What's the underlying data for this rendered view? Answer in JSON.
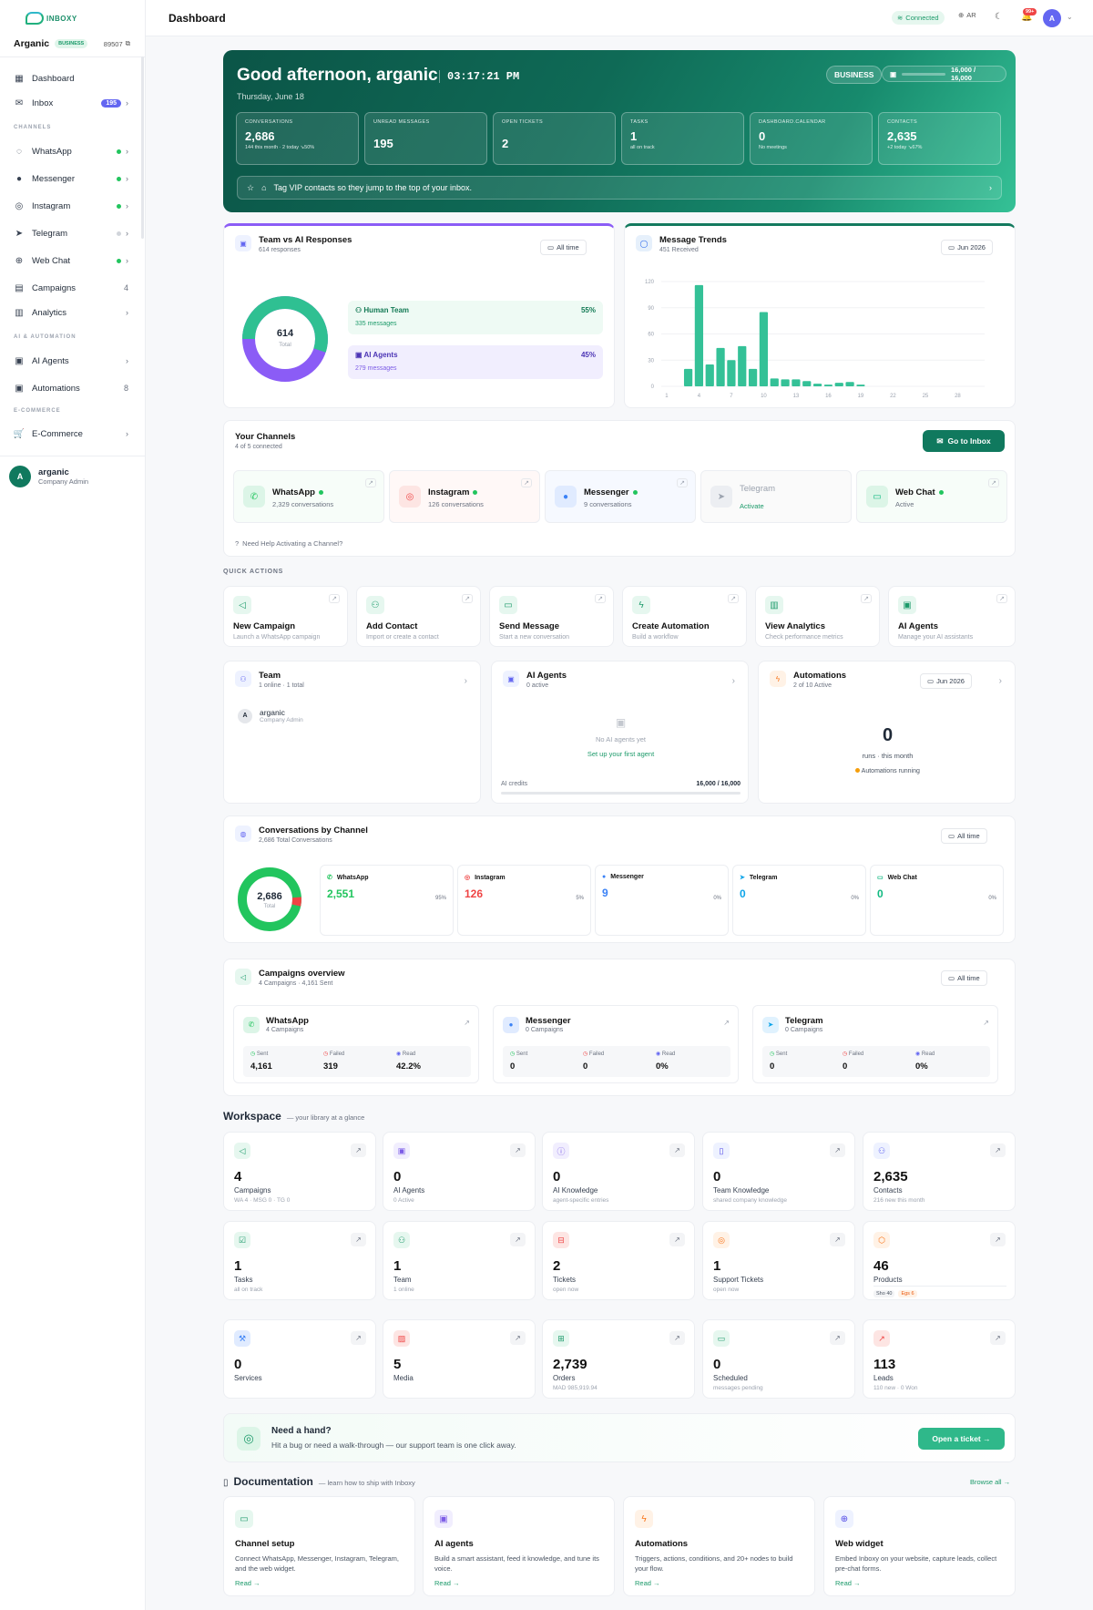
{
  "app": {
    "brand": "INBOXY",
    "page_title": "Dashboard"
  },
  "sidebar": {
    "workspace": "Arganic",
    "plan_badge": "BUSINESS",
    "workspace_id": "89507",
    "items": [
      {
        "label": "Dashboard",
        "icon": "grid-icon"
      },
      {
        "label": "Inbox",
        "icon": "inbox-icon",
        "badge": "195"
      },
      {
        "label": "WhatsApp",
        "icon": "whatsapp-icon"
      },
      {
        "label": "Messenger",
        "icon": "messenger-icon"
      },
      {
        "label": "Instagram",
        "icon": "instagram-icon"
      },
      {
        "label": "Telegram",
        "icon": "telegram-icon"
      },
      {
        "label": "Web Chat",
        "icon": "globe-icon"
      },
      {
        "label": "Campaigns",
        "icon": "megaphone-icon",
        "count": "4"
      },
      {
        "label": "Analytics",
        "icon": "chart-icon"
      },
      {
        "label": "AI Agents",
        "icon": "bot-icon"
      },
      {
        "label": "Automations",
        "icon": "automation-icon",
        "count": "8"
      },
      {
        "label": "E-Commerce",
        "icon": "cart-icon"
      }
    ],
    "sections": {
      "channels": "CHANNELS",
      "ai": "AI & AUTOMATION",
      "ecommerce": "E-COMMERCE"
    },
    "user": {
      "initial": "A",
      "name": "arganic",
      "role": "Company Admin"
    }
  },
  "topbar": {
    "status": "Connected",
    "lang": "AR",
    "notifications": "99+",
    "avatar": "A"
  },
  "hero": {
    "greeting": "Good afternoon, arganic",
    "clock": "03:17:21 PM",
    "date": "Thursday, June 18",
    "plan": "BUSINESS",
    "credits": "16,000 / 16,000",
    "stats": [
      {
        "label": "CONVERSATIONS",
        "value": "2,686",
        "sub": "144 this month · 2 today   ↘50%"
      },
      {
        "label": "UNREAD MESSAGES",
        "value": "195",
        "sub": ""
      },
      {
        "label": "OPEN TICKETS",
        "value": "2",
        "sub": ""
      },
      {
        "label": "TASKS",
        "value": "1",
        "sub": "all on track"
      },
      {
        "label": "DASHBOARD.CALENDAR",
        "value": "0",
        "sub": "No meetings"
      },
      {
        "label": "CONTACTS",
        "value": "2,635",
        "sub": "+2 today   ↘67%"
      }
    ],
    "tip": "Tag VIP contacts so they jump to the top of your inbox."
  },
  "team_vs_ai": {
    "title": "Team vs AI Responses",
    "subtitle": "614 responses",
    "filter": "All time",
    "total": "614",
    "total_label": "Total",
    "human": {
      "label": "Human Team",
      "pct": "55%",
      "sub": "335 messages"
    },
    "ai": {
      "label": "AI Agents",
      "pct": "45%",
      "sub": "279 messages"
    }
  },
  "trends": {
    "title": "Message Trends",
    "subtitle": "451 Received",
    "filter": "Jun 2026"
  },
  "chart_data": {
    "type": "bar",
    "x": [
      1,
      2,
      3,
      4,
      5,
      6,
      7,
      8,
      9,
      10,
      11,
      12,
      13,
      14,
      15,
      16,
      17,
      18,
      19,
      20,
      21,
      22,
      23,
      24,
      25,
      26,
      27,
      28,
      29,
      30
    ],
    "values": [
      0,
      0,
      20,
      116,
      25,
      44,
      30,
      46,
      20,
      85,
      9,
      8,
      8,
      6,
      3,
      2,
      4,
      5,
      2,
      0,
      0,
      0,
      0,
      0,
      0,
      0,
      0,
      0,
      0,
      0
    ],
    "xticks": [
      "1",
      "4",
      "7",
      "10",
      "13",
      "16",
      "19",
      "22",
      "25",
      "28"
    ],
    "yticks": [
      "0",
      "30",
      "60",
      "90",
      "120"
    ],
    "ylim": [
      0,
      120
    ]
  },
  "channels": {
    "title": "Your Channels",
    "subtitle": "4 of 5 connected",
    "go_inbox": "Go to Inbox",
    "help": "Need Help Activating a Channel?",
    "items": [
      {
        "name": "WhatsApp",
        "status": "2,329 conversations"
      },
      {
        "name": "Instagram",
        "status": "126 conversations"
      },
      {
        "name": "Messenger",
        "status": "9 conversations"
      },
      {
        "name": "Telegram",
        "status": "Activate"
      },
      {
        "name": "Web Chat",
        "status": "Active"
      }
    ]
  },
  "quick_actions": {
    "title": "QUICK ACTIONS",
    "items": [
      {
        "title": "New Campaign",
        "sub": "Launch a WhatsApp campaign"
      },
      {
        "title": "Add Contact",
        "sub": "Import or create a contact"
      },
      {
        "title": "Send Message",
        "sub": "Start a new conversation"
      },
      {
        "title": "Create Automation",
        "sub": "Build a workflow"
      },
      {
        "title": "View Analytics",
        "sub": "Check performance metrics"
      },
      {
        "title": "AI Agents",
        "sub": "Manage your AI assistants"
      }
    ]
  },
  "team": {
    "title": "Team",
    "subtitle": "1 online · 1 total",
    "member": "arganic",
    "member_role": "Company Admin",
    "initial": "A"
  },
  "ai_agents": {
    "title": "AI Agents",
    "subtitle": "0 active",
    "empty": "No AI agents yet",
    "setup": "Set up your first agent",
    "credits_label": "AI credits",
    "credits": "16,000 / 16,000"
  },
  "automations": {
    "title": "Automations",
    "subtitle": "2 of 10 Active",
    "filter": "Jun 2026",
    "value": "0",
    "runs": "runs · this month",
    "running": "Automations running"
  },
  "conv_by_channel": {
    "title": "Conversations by Channel",
    "subtitle": "2,686 Total Conversations",
    "filter": "All time",
    "total": "2,686",
    "total_label": "Total",
    "items": [
      {
        "name": "WhatsApp",
        "value": "2,551",
        "pct": "95%",
        "color": "#22c55e"
      },
      {
        "name": "Instagram",
        "value": "126",
        "pct": "5%",
        "color": "#ef4444"
      },
      {
        "name": "Messenger",
        "value": "9",
        "pct": "0%",
        "color": "#3b82f6"
      },
      {
        "name": "Telegram",
        "value": "0",
        "pct": "0%",
        "color": "#0ea5e9"
      },
      {
        "name": "Web Chat",
        "value": "0",
        "pct": "0%",
        "color": "#10b981"
      }
    ]
  },
  "campaigns": {
    "title": "Campaigns overview",
    "subtitle": "4 Campaigns · 4,161 Sent",
    "filter": "All time",
    "labels": {
      "sent": "Sent",
      "failed": "Failed",
      "read": "Read"
    },
    "items": [
      {
        "name": "WhatsApp",
        "sub": "4 Campaigns",
        "sent": "4,161",
        "failed": "319",
        "read": "42.2%"
      },
      {
        "name": "Messenger",
        "sub": "0 Campaigns",
        "sent": "0",
        "failed": "0",
        "read": "0%"
      },
      {
        "name": "Telegram",
        "sub": "0 Campaigns",
        "sent": "0",
        "failed": "0",
        "read": "0%"
      }
    ]
  },
  "workspace": {
    "title": "Workspace",
    "subtitle": "— your library at a glance",
    "items": [
      {
        "value": "4",
        "title": "Campaigns",
        "sub": "WA 4 · MSG 0 · TG 0"
      },
      {
        "value": "0",
        "title": "AI Agents",
        "sub": "0 Active"
      },
      {
        "value": "0",
        "title": "AI Knowledge",
        "sub": "agent-specific entries"
      },
      {
        "value": "0",
        "title": "Team Knowledge",
        "sub": "shared company knowledge"
      },
      {
        "value": "2,635",
        "title": "Contacts",
        "sub": "216 new this month"
      },
      {
        "value": "1",
        "title": "Tasks",
        "sub": "all on track"
      },
      {
        "value": "1",
        "title": "Team",
        "sub": "1 online"
      },
      {
        "value": "2",
        "title": "Tickets",
        "sub": "open now"
      },
      {
        "value": "1",
        "title": "Support Tickets",
        "sub": "open now"
      },
      {
        "value": "46",
        "title": "Products",
        "sub": ""
      },
      {
        "value": "0",
        "title": "Services",
        "sub": ""
      },
      {
        "value": "5",
        "title": "Media",
        "sub": ""
      },
      {
        "value": "2,739",
        "title": "Orders",
        "sub": "MAD 985,919.94"
      },
      {
        "value": "0",
        "title": "Scheduled",
        "sub": "messages pending"
      },
      {
        "value": "113",
        "title": "Leads",
        "sub": "110 new · 0 Won"
      }
    ],
    "product_tags": {
      "shopify": "Sho 40",
      "other": "Egs 6"
    }
  },
  "help": {
    "title": "Need a hand?",
    "sub": "Hit a bug or need a walk-through — our support team is one click away.",
    "button": "Open a ticket →"
  },
  "docs": {
    "title": "Documentation",
    "subtitle": "— learn how to ship with Inboxy",
    "browse": "Browse all →",
    "items": [
      {
        "title": "Channel setup",
        "sub": "Connect WhatsApp, Messenger, Instagram, Telegram, and the web widget.",
        "read": "Read →"
      },
      {
        "title": "AI agents",
        "sub": "Build a smart assistant, feed it knowledge, and tune its voice.",
        "read": "Read →"
      },
      {
        "title": "Automations",
        "sub": "Triggers, actions, conditions, and 20+ nodes to build your flow.",
        "read": "Read →"
      },
      {
        "title": "Web widget",
        "sub": "Embed Inboxy on your website, capture leads, collect pre-chat forms.",
        "read": "Read →"
      }
    ]
  }
}
